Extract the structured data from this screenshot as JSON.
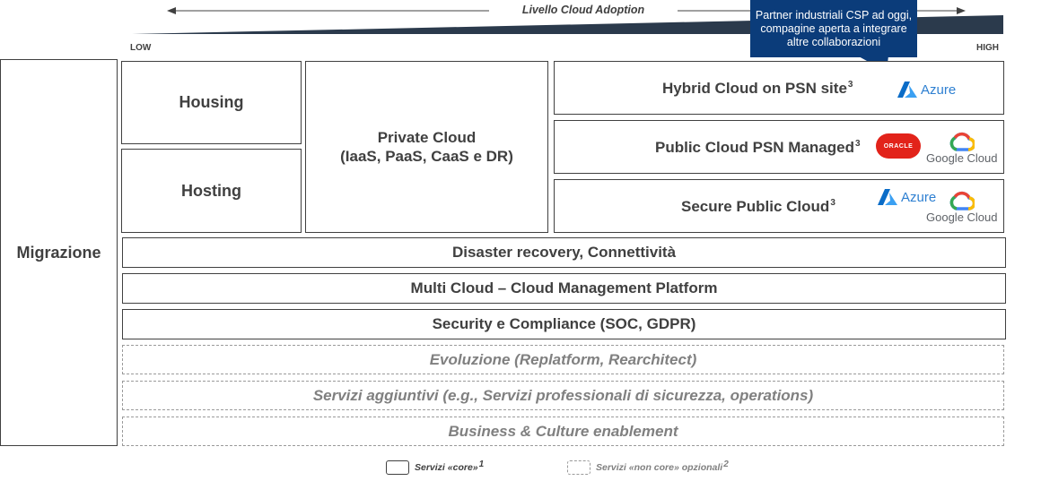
{
  "adoption": {
    "title": "Livello Cloud Adoption",
    "low": "LOW",
    "high": "HIGH"
  },
  "callout": "Partner industriali CSP ad oggi, compagine aperta a integrare altre collaborazioni",
  "migrazione": "Migrazione",
  "housing": "Housing",
  "hosting": "Hosting",
  "private_cloud": {
    "line1": "Private Cloud",
    "line2": "(IaaS, PaaS, CaaS e DR)"
  },
  "hybrid": {
    "label": "Hybrid Cloud on PSN site",
    "sup": "3"
  },
  "public_managed": {
    "label": "Public Cloud PSN Managed",
    "sup": "3"
  },
  "secure_public": {
    "label": "Secure Public Cloud",
    "sup": "3"
  },
  "logos": {
    "azure": "Azure",
    "google": "Google Cloud",
    "oracle": "ORACLE"
  },
  "core_rows": [
    "Disaster recovery, Connettività",
    "Multi Cloud – Cloud Management Platform",
    "Security e Compliance (SOC, GDPR)"
  ],
  "optional_rows": [
    "Evoluzione (Replatform, Rearchitect)",
    "Servizi aggiuntivi (e.g., Servizi professionali di sicurezza, operations)",
    "Business & Culture enablement"
  ],
  "legend": {
    "core": "Servizi «core»",
    "core_sup": "1",
    "noncore": "Servizi «non core» opzionali",
    "noncore_sup": "2"
  },
  "colors": {
    "callout_bg": "#0b3c7a",
    "wedge": "#1f2d3d",
    "azure": "#2d7fd1",
    "oracle": "#e2231a"
  }
}
